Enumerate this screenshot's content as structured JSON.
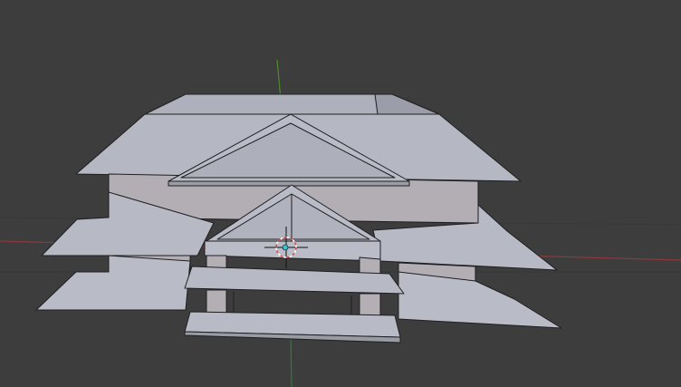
{
  "viewport": {
    "background": "#3d3d3d",
    "grid_line_color": "#383838",
    "x_axis_color": "#8a3a3f",
    "y_axis_color": "#4f8a2f",
    "z_axis_color": "#2e7d3a"
  },
  "model": {
    "roof_light": "#b9bcc6",
    "roof_mid": "#a7aab5",
    "roof_dark": "#8e909a",
    "wall_color": "#b6b1b6",
    "wall_shadow": "#a8a3a9",
    "edge_color": "#1f1f22"
  },
  "cursor_3d": {
    "ring_color": "#e34b4b",
    "ring_alt_color": "#ffffff",
    "origin_color": "#38c4d6"
  }
}
